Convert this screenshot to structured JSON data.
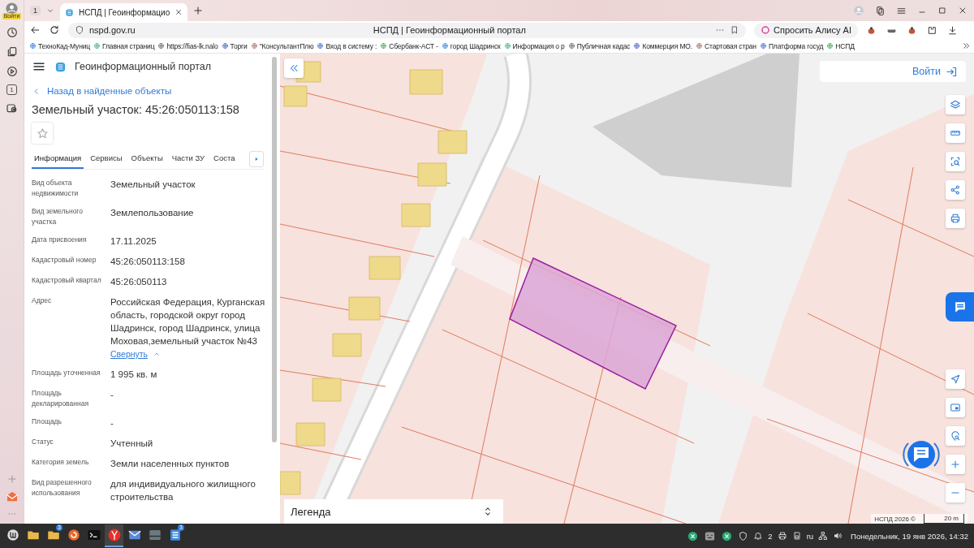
{
  "browser": {
    "profile_label": "Войти",
    "sidebar_counter": "1",
    "tab_counter": "1",
    "tabs": [
      {
        "label": "НСПД | Геоинформацио",
        "selected": true
      }
    ],
    "address": "nspd.gov.ru",
    "page_title": "НСПД | Геоинформационный портал",
    "alice_button": "Спросить Алису AI",
    "bookmarks": [
      "ТехноКад-Муниц",
      "Главная страниц",
      "https://fias-lk.nalo",
      "Торги",
      "\"КонсультантПлю",
      "Вход в систему :",
      "Сбербанк-АСТ -",
      "город Шадринск",
      "Информация о р",
      "Публичная кадас",
      "Коммерция МО.",
      "Стартовая стран",
      "Платформа госуд",
      "НСПД"
    ]
  },
  "portal": {
    "title": "Геоинформационный портал",
    "back_link": "Назад в найденные объекты",
    "heading": "Земельный участок: 45:26:050113:158",
    "favorite": false,
    "tabs": [
      {
        "label": "Информация",
        "selected": true
      },
      {
        "label": "Сервисы",
        "selected": false
      },
      {
        "label": "Объекты",
        "selected": false
      },
      {
        "label": "Части ЗУ",
        "selected": false
      },
      {
        "label": "Соста",
        "selected": false
      }
    ],
    "fields": [
      {
        "label": "Вид объекта недвижимости",
        "value": "Земельный участок"
      },
      {
        "label": "Вид земельного участка",
        "value": "Землепользование"
      },
      {
        "label": "Дата присвоения",
        "value": "17.11.2025"
      },
      {
        "label": "Кадастровый номер",
        "value": "45:26:050113:158"
      },
      {
        "label": "Кадастровый квартал",
        "value": "45:26:050113"
      },
      {
        "label": "Адрес",
        "value": "Российская Федерация, Курганская область, городской округ город Шадринск, город Шадринск, улица Моховая,земельный участок №43",
        "link": "Свернуть"
      },
      {
        "label": "Площадь уточненная",
        "value": "1 995 кв. м"
      },
      {
        "label": "Площадь декларированная",
        "value": "-"
      },
      {
        "label": "Площадь",
        "value": "-"
      },
      {
        "label": "Статус",
        "value": "Учтенный"
      },
      {
        "label": "Категория земель",
        "value": "Земли населенных пунктов"
      },
      {
        "label": "Вид разрешенного использования",
        "value": "для индивидуального жилищного строительства"
      }
    ]
  },
  "map": {
    "login_button": "Войти",
    "legend": "Легенда",
    "attribution": "НСПД 2026 ©",
    "scale": "20 m"
  },
  "taskbar": {
    "apps": [
      {
        "kind": "menu",
        "selected": false
      },
      {
        "kind": "folder",
        "selected": false
      },
      {
        "kind": "folder",
        "selected": false,
        "badge": "3"
      },
      {
        "kind": "updater",
        "selected": false
      },
      {
        "kind": "terminal",
        "selected": false
      },
      {
        "kind": "browser",
        "selected": true
      },
      {
        "kind": "mail",
        "selected": false
      },
      {
        "kind": "window",
        "selected": false
      },
      {
        "kind": "notes",
        "selected": false,
        "badge": "3"
      }
    ],
    "notification_count": "2",
    "keyboard_layout": "ru",
    "clock": "Понедельник, 19 янв 2026, 14:32"
  }
}
